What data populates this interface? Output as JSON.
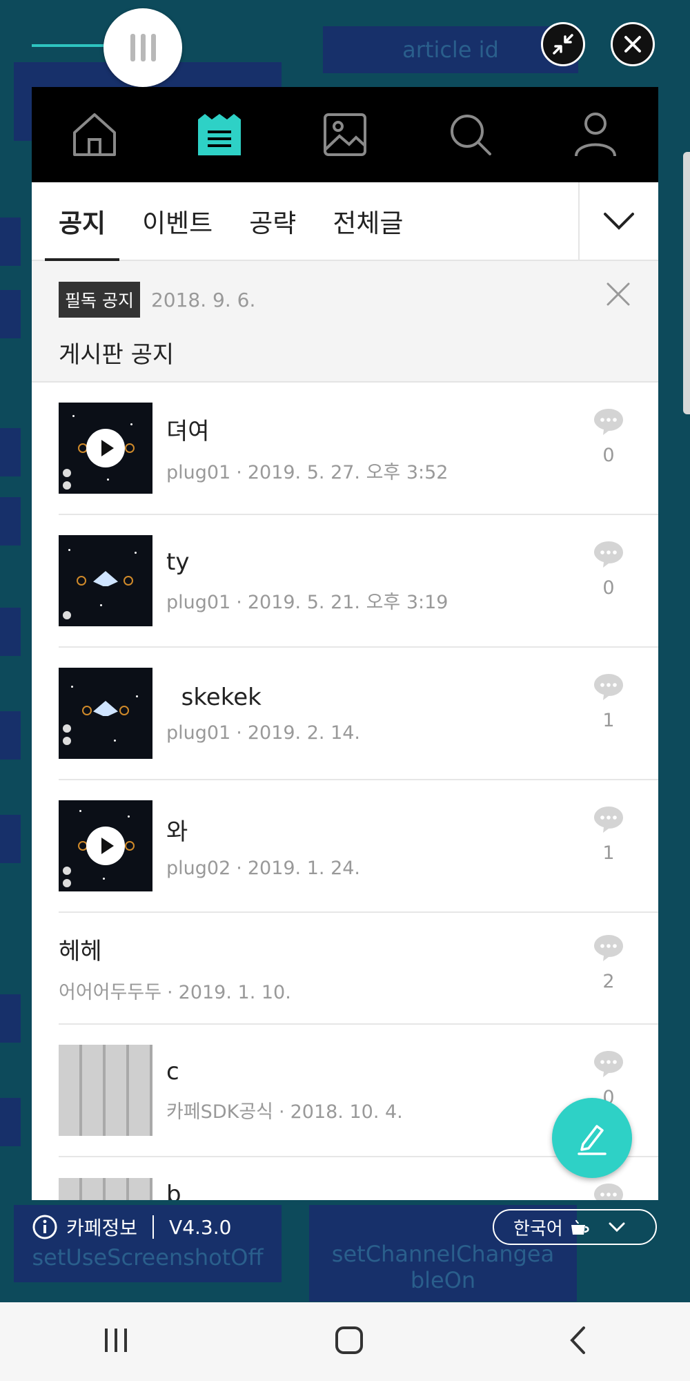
{
  "background_app": {
    "article_id_placeholder": "article id",
    "left_button": "setUseScreenshotOff",
    "right_button": "setChannelChangeableOn"
  },
  "nav_icons": [
    "home-icon",
    "board-icon",
    "image-icon",
    "search-icon",
    "profile-icon"
  ],
  "tabs": [
    {
      "label": "공지"
    },
    {
      "label": "이벤트"
    },
    {
      "label": "공략"
    },
    {
      "label": "전체글"
    }
  ],
  "notice": {
    "badge": "필독 공지",
    "date": "2018. 9. 6.",
    "title": "게시판 공지"
  },
  "posts": [
    {
      "title": "뎌여",
      "author": "plug01",
      "date": "2019. 5. 27. 오후 3:52",
      "comments": "0",
      "thumb": "video"
    },
    {
      "title": "ty",
      "author": "plug01",
      "date": "2019. 5. 21. 오후 3:19",
      "comments": "0",
      "thumb": "ship"
    },
    {
      "title": "  skekek",
      "author": "plug01",
      "date": "2019. 2. 14.",
      "comments": "1",
      "thumb": "ship"
    },
    {
      "title": "와",
      "author": "plug02",
      "date": "2019. 1. 24.",
      "comments": "1",
      "thumb": "video"
    },
    {
      "title": "헤헤",
      "author": "어어어두두두",
      "date": "2019. 1. 10.",
      "comments": "2",
      "thumb": "none"
    },
    {
      "title": "c",
      "author": "카페SDK공식",
      "date": "2018. 10. 4.",
      "comments": "0",
      "thumb": "keyboard"
    },
    {
      "title": "b",
      "author": "",
      "date": "",
      "comments": "",
      "thumb": "keyboard"
    }
  ],
  "info_bar": {
    "cafe_info": "카페정보",
    "version": "V4.3.0"
  },
  "language": {
    "selected": "한국어"
  },
  "colors": {
    "accent": "#2ED1C6",
    "background": "#0D4A5B",
    "nav_bar": "#000000"
  }
}
